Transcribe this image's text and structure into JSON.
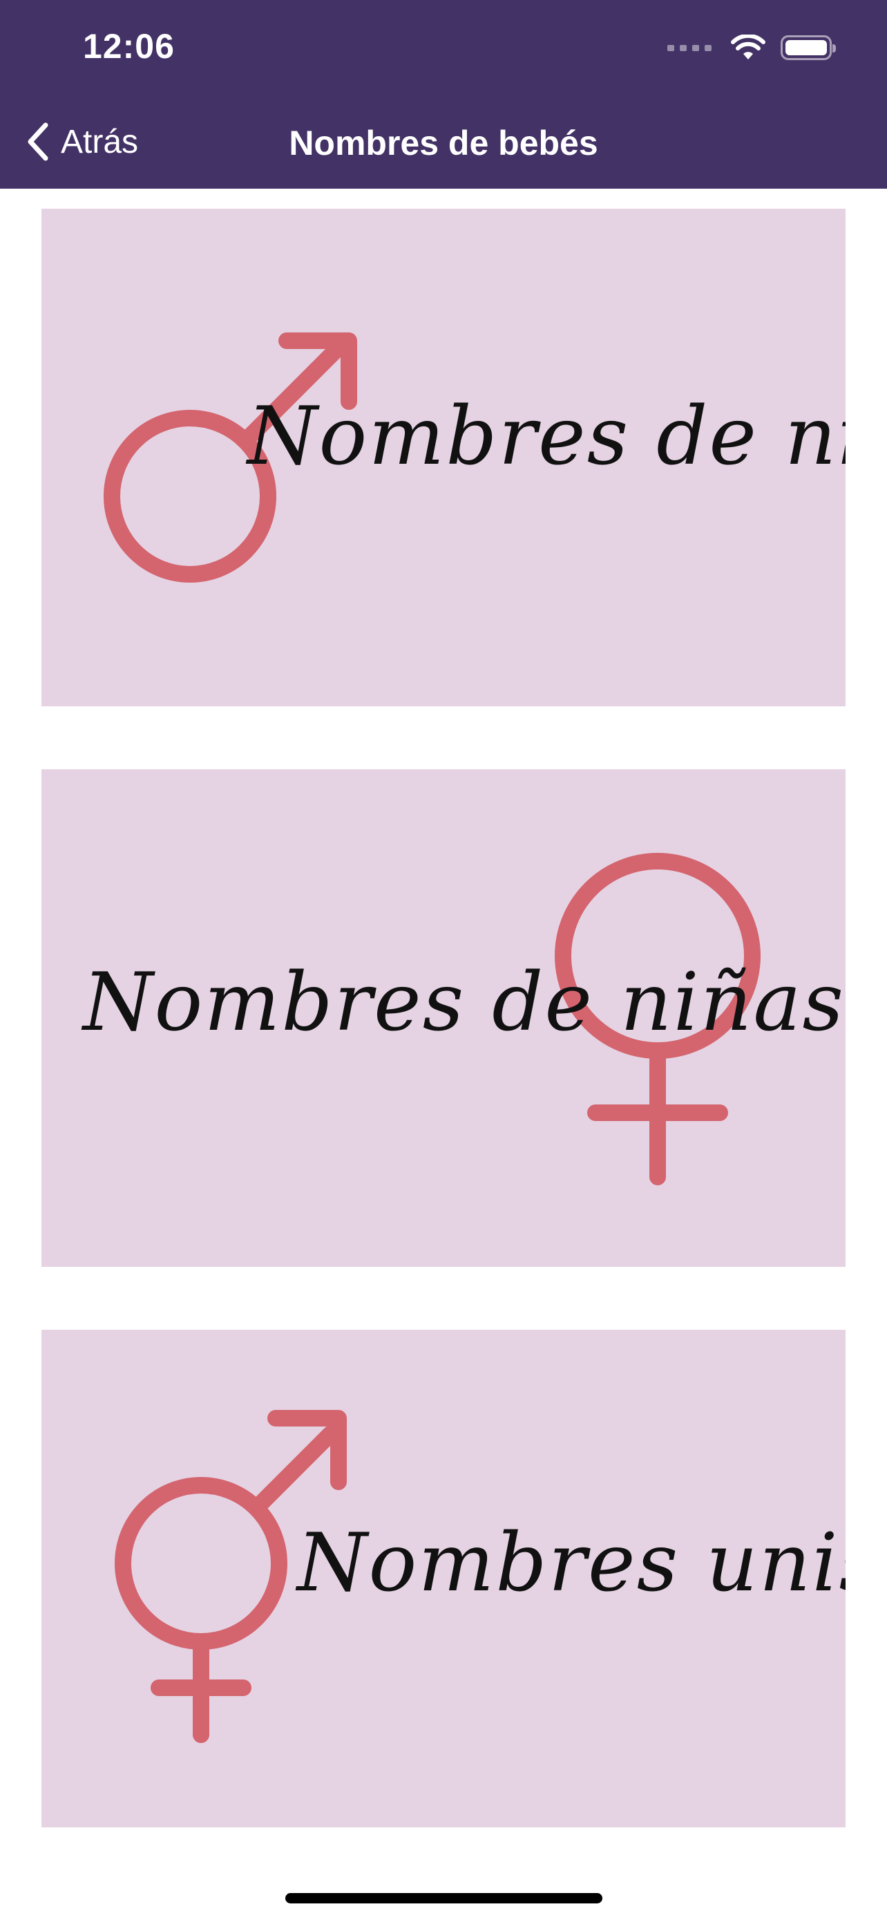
{
  "status_bar": {
    "time": "12:06",
    "signal_icon": "signal-bars-icon",
    "wifi_icon": "wifi-icon",
    "battery_icon": "battery-icon"
  },
  "nav": {
    "back_label": "Atrás",
    "back_icon": "chevron-left-icon",
    "title": "Nombres de bebés"
  },
  "cards": [
    {
      "label": "Nombres de niños",
      "icon": "male-symbol-icon"
    },
    {
      "label": "Nombres de niñas",
      "icon": "female-symbol-icon"
    },
    {
      "label": "Nombres unisex",
      "icon": "unisex-symbol-icon"
    }
  ],
  "colors": {
    "header_bg": "#433266",
    "card_bg": "#e5d3e3",
    "symbol": "#d4646e"
  }
}
